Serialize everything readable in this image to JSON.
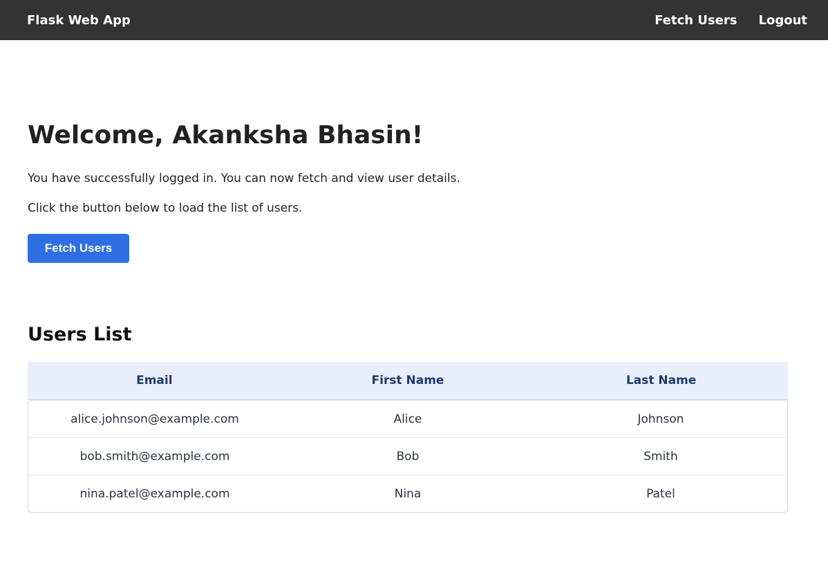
{
  "navbar": {
    "brand": "Flask Web App",
    "links": [
      {
        "label": "Fetch Users"
      },
      {
        "label": "Logout"
      }
    ]
  },
  "main": {
    "welcome": "Welcome, Akanksha Bhasin!",
    "paragraph1": "You have successfully logged in. You can now fetch and view user details.",
    "paragraph2": "Click the button below to load the list of users.",
    "fetch_button": "Fetch Users"
  },
  "users": {
    "title": "Users List",
    "columns": [
      "Email",
      "First Name",
      "Last Name"
    ],
    "rows": [
      [
        "alice.johnson@example.com",
        "Alice",
        "Johnson"
      ],
      [
        "bob.smith@example.com",
        "Bob",
        "Smith"
      ],
      [
        "nina.patel@example.com",
        "Nina",
        "Patel"
      ]
    ]
  },
  "colors": {
    "navbar_bg": "#333333",
    "button_bg": "#2f6fe4",
    "table_header_bg": "#e8effb",
    "table_header_text": "#1f3a6b"
  }
}
